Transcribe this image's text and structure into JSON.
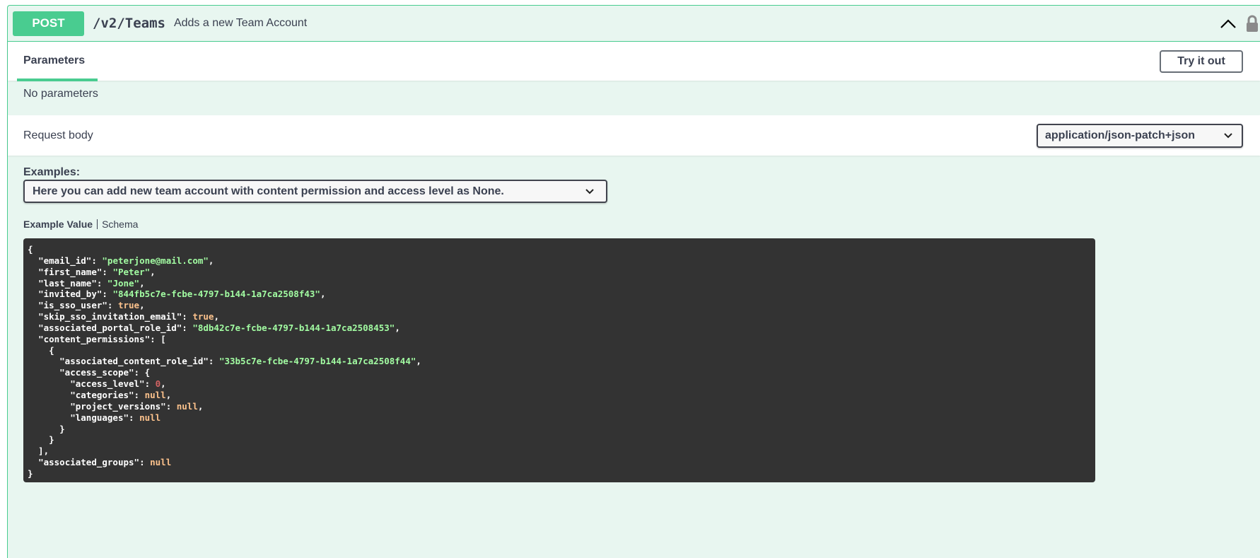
{
  "operation": {
    "method": "POST",
    "path": "/v2/Teams",
    "summary": "Adds a new Team Account"
  },
  "parameters": {
    "tab_label": "Parameters",
    "try_button": "Try it out",
    "empty_text": "No parameters"
  },
  "request_body": {
    "label": "Request body",
    "content_type": "application/json-patch+json",
    "examples_label": "Examples:",
    "example_selected": "Here you can add new team account with content permission and access level as None.",
    "tabs": [
      "Example Value",
      "Schema"
    ]
  },
  "example_json": {
    "email_id": "peterjone@mail.com",
    "first_name": "Peter",
    "last_name": "Jone",
    "invited_by": "844fb5c7e-fcbe-4797-b144-1a7ca2508f43",
    "is_sso_user": true,
    "skip_sso_invitation_email": true,
    "associated_portal_role_id": "8db42c7e-fcbe-4797-b144-1a7ca2508453",
    "content_permissions": [
      {
        "associated_content_role_id": "33b5c7e-fcbe-4797-b144-1a7ca2508f44",
        "access_scope": {
          "access_level": 0,
          "categories": null,
          "project_versions": null,
          "languages": null
        }
      }
    ],
    "associated_groups": null
  },
  "colors": {
    "post_green": "#49cc90",
    "block_bg": "#e8f6f0",
    "code_bg": "#333333",
    "json_string": "#a2fca2",
    "json_literal": "#fcc28c",
    "json_number": "#d36363"
  },
  "icons": [
    "chevron-up-icon",
    "lock-icon",
    "chevron-down-icon"
  ]
}
